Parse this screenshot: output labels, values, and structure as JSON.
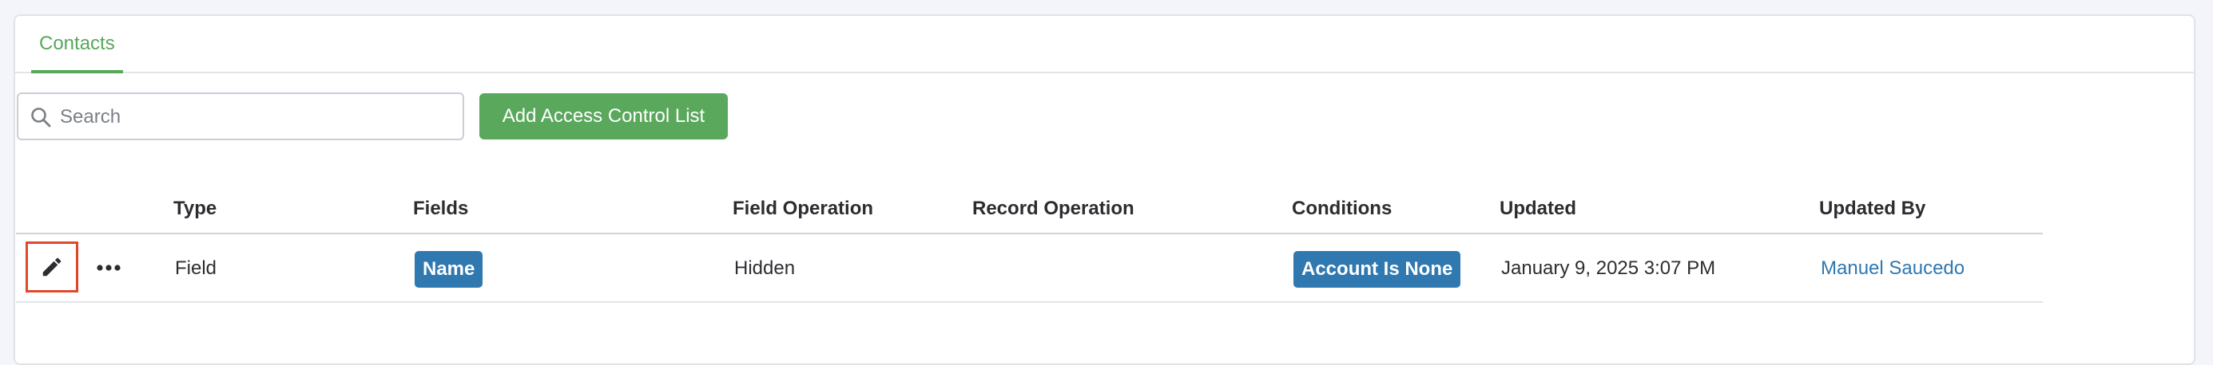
{
  "tabs": [
    {
      "label": "Contacts",
      "active": true
    }
  ],
  "search": {
    "placeholder": "Search",
    "value": ""
  },
  "toolbar": {
    "add_label": "Add Access Control List"
  },
  "table": {
    "columns": [
      "Type",
      "Fields",
      "Field Operation",
      "Record Operation",
      "Conditions",
      "Updated",
      "Updated By"
    ],
    "rows": [
      {
        "type": "Field",
        "fields": "Name",
        "field_operation": "Hidden",
        "record_operation": "",
        "conditions": "Account Is None",
        "updated": "January 9, 2025 3:07 PM",
        "updated_by": "Manuel Saucedo"
      }
    ]
  },
  "icons": {
    "search": "search-icon",
    "edit": "pencil-icon",
    "more": "more-horizontal-icon"
  },
  "colors": {
    "accent_green": "#5aa85c",
    "badge_blue": "#2f78b0",
    "highlight_red": "#e0482a",
    "link_blue": "#2f78b0"
  }
}
